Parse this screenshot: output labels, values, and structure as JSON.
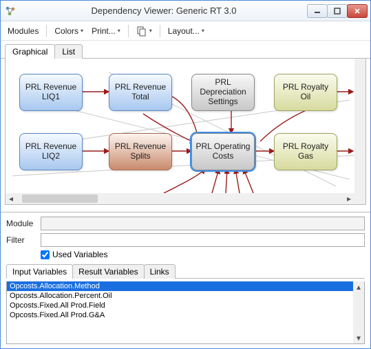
{
  "window": {
    "title": "Dependency Viewer: Generic RT 3.0"
  },
  "toolbar": {
    "modules": "Modules",
    "colors": "Colors",
    "print": "Print...",
    "layout": "Layout..."
  },
  "viewTabs": {
    "graphical": "Graphical",
    "list": "List"
  },
  "nodes": {
    "liq1": "PRL Revenue LIQ1",
    "total": "PRL Revenue Total",
    "depr": "PRL Depreciation Settings",
    "royoil": "PRL Royalty Oil",
    "liq2": "PRL Revenue LIQ2",
    "splits": "PRL Revenue Splits",
    "opcost": "PRL Operating Costs",
    "roygas": "PRL Royalty Gas"
  },
  "form": {
    "moduleLabel": "Module",
    "filterLabel": "Filter",
    "usedVars": "Used Variables"
  },
  "subtabs": {
    "input": "Input Variables",
    "result": "Result Variables",
    "links": "Links"
  },
  "inputVariables": [
    "Opcosts.Allocation.Method",
    "Opcosts.Allocation.Percent.Oil",
    "Opcosts.Fixed.All Prod.Field",
    "Opcosts.Fixed.All Prod.G&A"
  ]
}
